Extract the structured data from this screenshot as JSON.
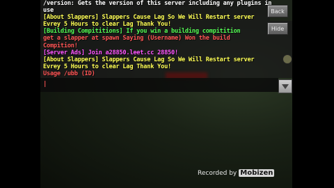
{
  "chat_lines": [
    {
      "text": "/version:  Gets the version of this server including any plugins in",
      "color": "#ffffff"
    },
    {
      "text": "use",
      "color": "#ffffff"
    },
    {
      "text": "[About Slappers]  Slappers Cause Lag So We Will Restart server",
      "color": "#ffff55"
    },
    {
      "text": "Evrey 5 Hours to clear Lag Thank You!",
      "color": "#ffff55"
    },
    {
      "text": "[Building Compititions] If you win a building compitition",
      "color": "#55ff55"
    },
    {
      "text": "get a slapper at spawn Saying (Username) Won the build",
      "color": "#ff5555"
    },
    {
      "text": "Compition!",
      "color": "#ff5555"
    },
    {
      "text": "[Server Ads]  Join a28850.leet.cc 28850!",
      "color": "#ff55ff"
    },
    {
      "text": "[About Slappers]  Slappers Cause Lag So We Will Restart server",
      "color": "#ffff55"
    },
    {
      "text": "Evrey 5 Hours to clear Lag Thank You!",
      "color": "#ffff55"
    },
    {
      "text": "Usage /ubb (ID)",
      "color": "#ff5555"
    }
  ],
  "input": {
    "caret": "|"
  },
  "buttons": {
    "back": "Back",
    "hide": "Hide"
  },
  "icons": {
    "dropdown": "chevron-down-icon"
  },
  "watermark": {
    "prefix": "Recorded by",
    "brand": "Mobizen"
  }
}
